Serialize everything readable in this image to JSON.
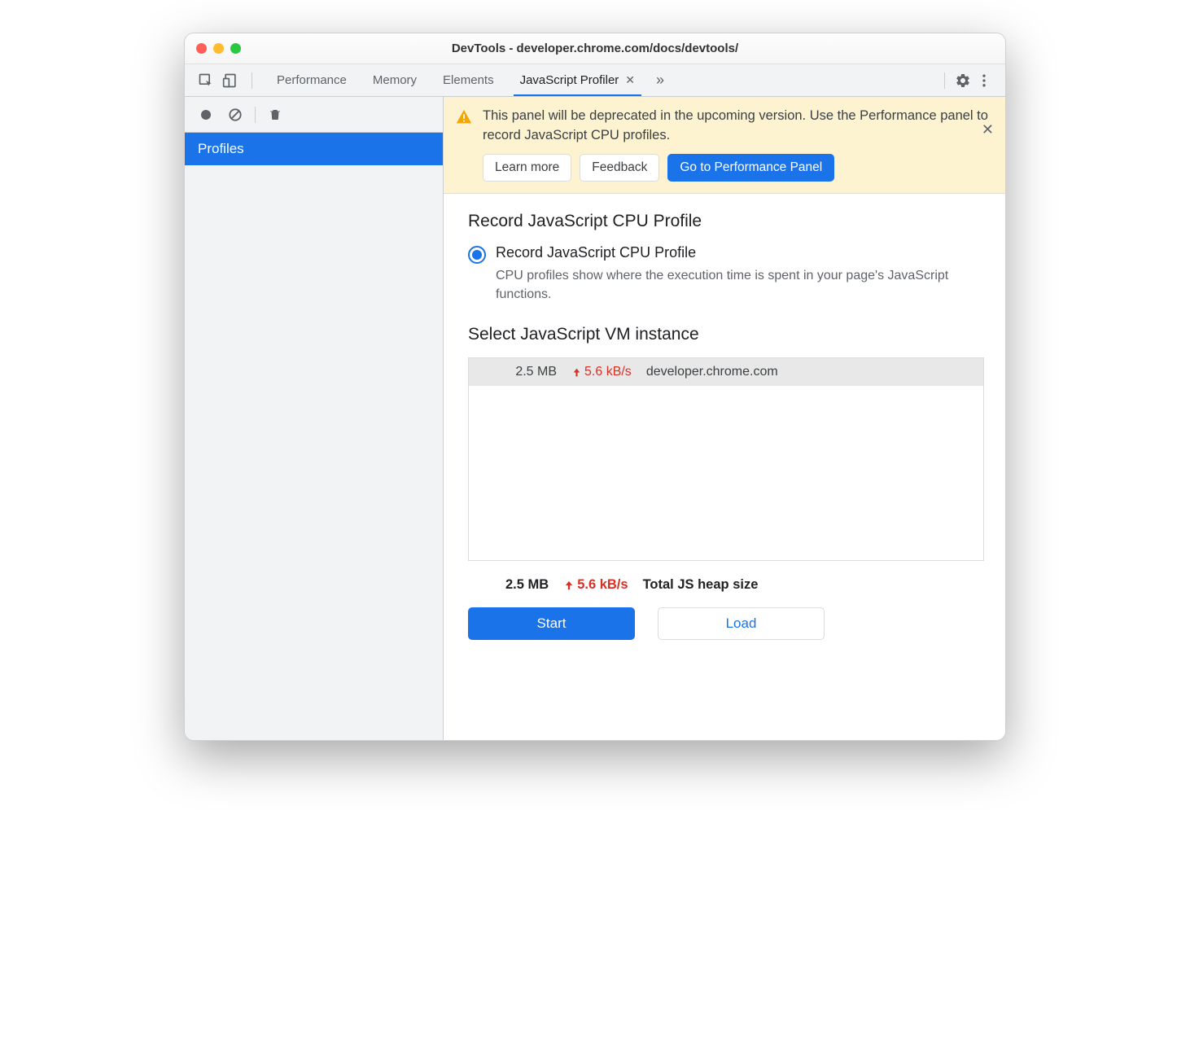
{
  "titlebar": {
    "title": "DevTools - developer.chrome.com/docs/devtools/"
  },
  "tabs": {
    "items": [
      {
        "label": "Performance"
      },
      {
        "label": "Memory"
      },
      {
        "label": "Elements"
      },
      {
        "label": "JavaScript Profiler"
      }
    ],
    "activeIndex": 3
  },
  "sidebar": {
    "item_label": "Profiles"
  },
  "banner": {
    "text": "This panel will be deprecated in the upcoming version. Use the Performance panel to record JavaScript CPU profiles.",
    "learn_more": "Learn more",
    "feedback": "Feedback",
    "goto": "Go to Performance Panel"
  },
  "panel": {
    "record_title": "Record JavaScript CPU Profile",
    "radio_label": "Record JavaScript CPU Profile",
    "radio_desc": "CPU profiles show where the execution time is spent in your page's JavaScript functions.",
    "vm_title": "Select JavaScript VM instance",
    "vm_row": {
      "size": "2.5 MB",
      "rate": "5.6 kB/s",
      "url": "developer.chrome.com"
    },
    "totals": {
      "size": "2.5 MB",
      "rate": "5.6 kB/s",
      "label": "Total JS heap size"
    },
    "start": "Start",
    "load": "Load"
  }
}
